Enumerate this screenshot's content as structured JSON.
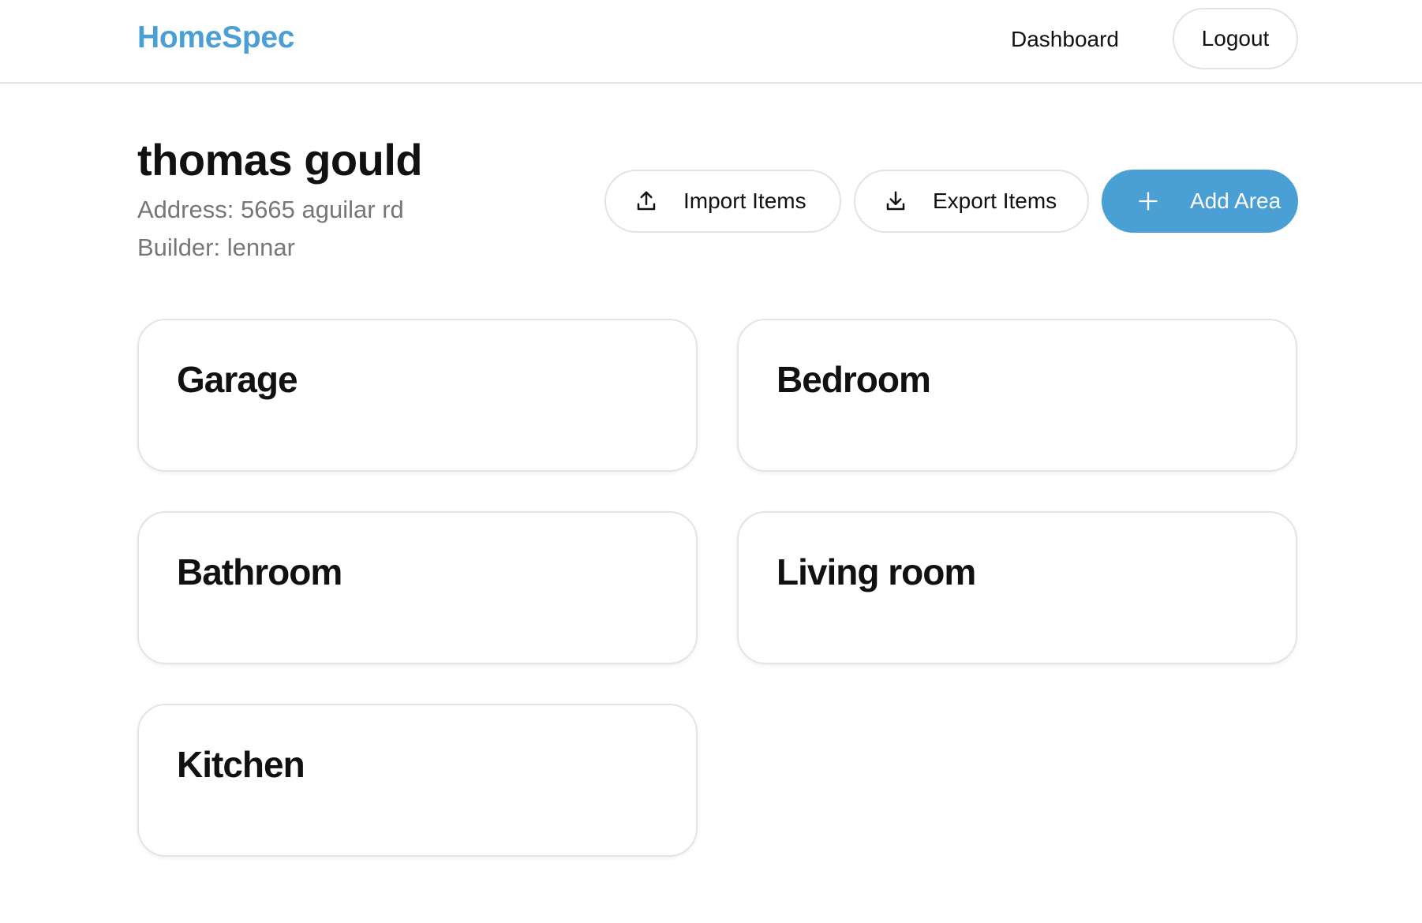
{
  "header": {
    "brand": "HomeSpec",
    "nav_dashboard": "Dashboard",
    "logout_label": "Logout",
    "brand_color": "#4a9fd4"
  },
  "profile": {
    "name": "thomas gould",
    "address": "Address: 5665 aguilar rd",
    "builder": "Builder: lennar"
  },
  "actions": {
    "import_label": "Import Items",
    "import_icon": "upload-icon",
    "export_label": "Export Items",
    "export_icon": "download-icon",
    "add_label": "Add Area",
    "add_icon": "plus-icon",
    "accent_color": "#4a9fd4"
  },
  "areas": [
    {
      "name": "Garage"
    },
    {
      "name": "Bedroom"
    },
    {
      "name": "Bathroom"
    },
    {
      "name": "Living room"
    },
    {
      "name": "Kitchen"
    }
  ]
}
